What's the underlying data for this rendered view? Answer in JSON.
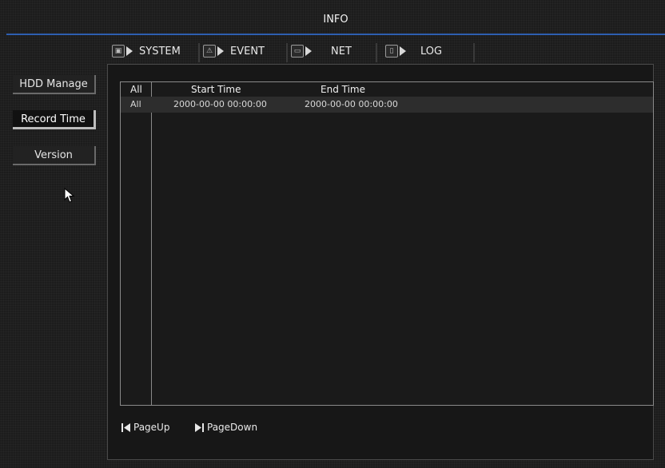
{
  "window": {
    "title": "INFO"
  },
  "sidebar": {
    "items": [
      {
        "label": "HDD Manage",
        "active": false
      },
      {
        "label": "Record Time",
        "active": true
      },
      {
        "label": "Version",
        "active": false
      }
    ]
  },
  "tabs": [
    {
      "label": "SYSTEM",
      "icon": "system-icon",
      "active": true
    },
    {
      "label": "EVENT",
      "icon": "event-icon",
      "active": false
    },
    {
      "label": "NET",
      "icon": "net-icon",
      "active": false
    },
    {
      "label": "LOG",
      "icon": "log-icon",
      "active": false
    }
  ],
  "table": {
    "headers": [
      "All",
      "Start Time",
      "End Time"
    ],
    "rows": [
      {
        "channel": "All",
        "start": "2000-00-00 00:00:00",
        "end": "2000-00-00 00:00:00"
      }
    ]
  },
  "pager": {
    "page_up": "PageUp",
    "page_down": "PageDown"
  },
  "colors": {
    "accent_line": "#2e5fb0",
    "background": "#1c1c1c"
  }
}
